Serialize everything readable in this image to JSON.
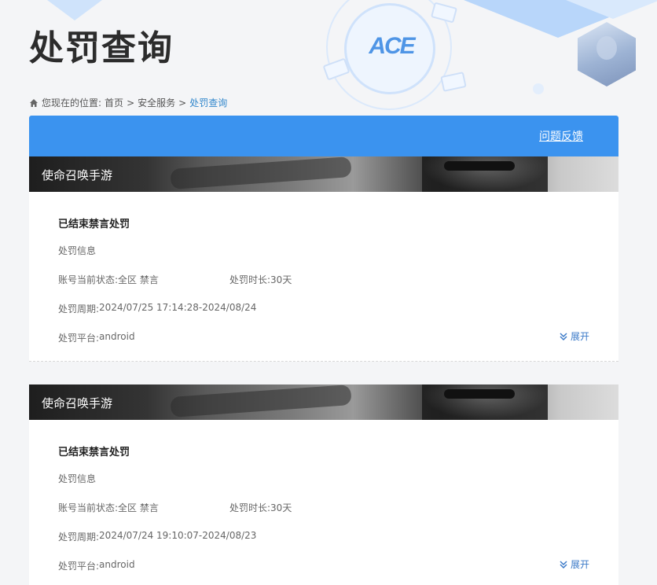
{
  "page": {
    "title": "处罚查询"
  },
  "breadcrumb": {
    "prefix": "您现在的位置:",
    "items": [
      "首页",
      "安全服务",
      "处罚查询"
    ],
    "separator": ">"
  },
  "header": {
    "logo_text": "ACE",
    "feedback_label": "问题反馈",
    "accent_color": "#3b93ef"
  },
  "records": [
    {
      "game": "使命召唤手游",
      "status_title": "已结束禁言处罚",
      "info_label": "处罚信息",
      "account_state_label": "账号当前状态:",
      "account_state_value": "全区 禁言",
      "duration_label": "处罚时长:",
      "duration_value": "30天",
      "period_label": "处罚周期:",
      "period_value": "2024/07/25 17:14:28-2024/08/24",
      "platform_label": "处罚平台:",
      "platform_value": "android",
      "expand_label": "展开"
    },
    {
      "game": "使命召唤手游",
      "status_title": "已结束禁言处罚",
      "info_label": "处罚信息",
      "account_state_label": "账号当前状态:",
      "account_state_value": "全区 禁言",
      "duration_label": "处罚时长:",
      "duration_value": "30天",
      "period_label": "处罚周期:",
      "period_value": "2024/07/24 19:10:07-2024/08/23",
      "platform_label": "处罚平台:",
      "platform_value": "android",
      "expand_label": "展开"
    }
  ]
}
